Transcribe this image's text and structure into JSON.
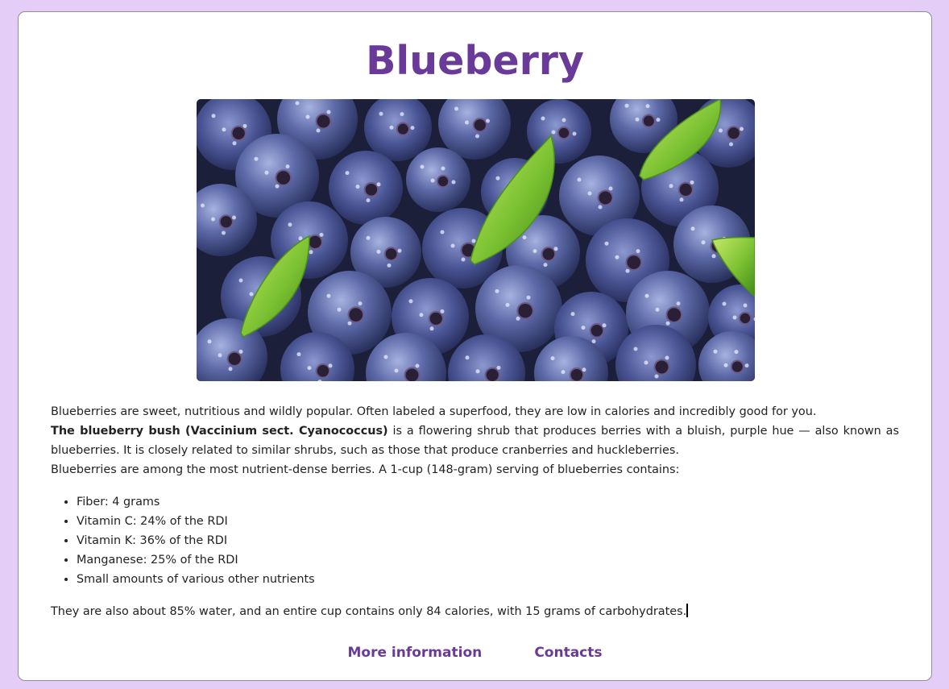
{
  "page": {
    "title": "Blueberry",
    "accent_color": "#6a3a99",
    "background_color": "#e4cdf6"
  },
  "image": {
    "alt": "Blueberry",
    "subject": "blueberries with green leaves"
  },
  "content": {
    "intro": "Blueberries are sweet, nutritious and wildly popular. Often labeled a superfood, they are low in calories and incredibly good for you.",
    "bush_bold": "The blueberry bush (Vaccinium sect. Cyanococcus)",
    "bush_rest": " is a flowering shrub that produces berries with a bluish, purple hue — also known as blueberries. It is closely related to similar shrubs, such as those that produce cranberries and huckleberries.",
    "nutrient_intro": "Blueberries are among the most nutrient-dense berries. A 1-cup (148-gram) serving of blueberries contains:",
    "nutrients": [
      "Fiber: 4 grams",
      "Vitamin C: 24% of the RDI",
      "Vitamin K: 36% of the RDI",
      "Manganese: 25% of the RDI",
      "Small amounts of various other nutrients"
    ],
    "closing": "They are also about 85% water, and an entire cup contains only 84 calories, with 15 grams of carbohydrates."
  },
  "footer": {
    "more_info": "More information",
    "contacts": "Contacts"
  }
}
